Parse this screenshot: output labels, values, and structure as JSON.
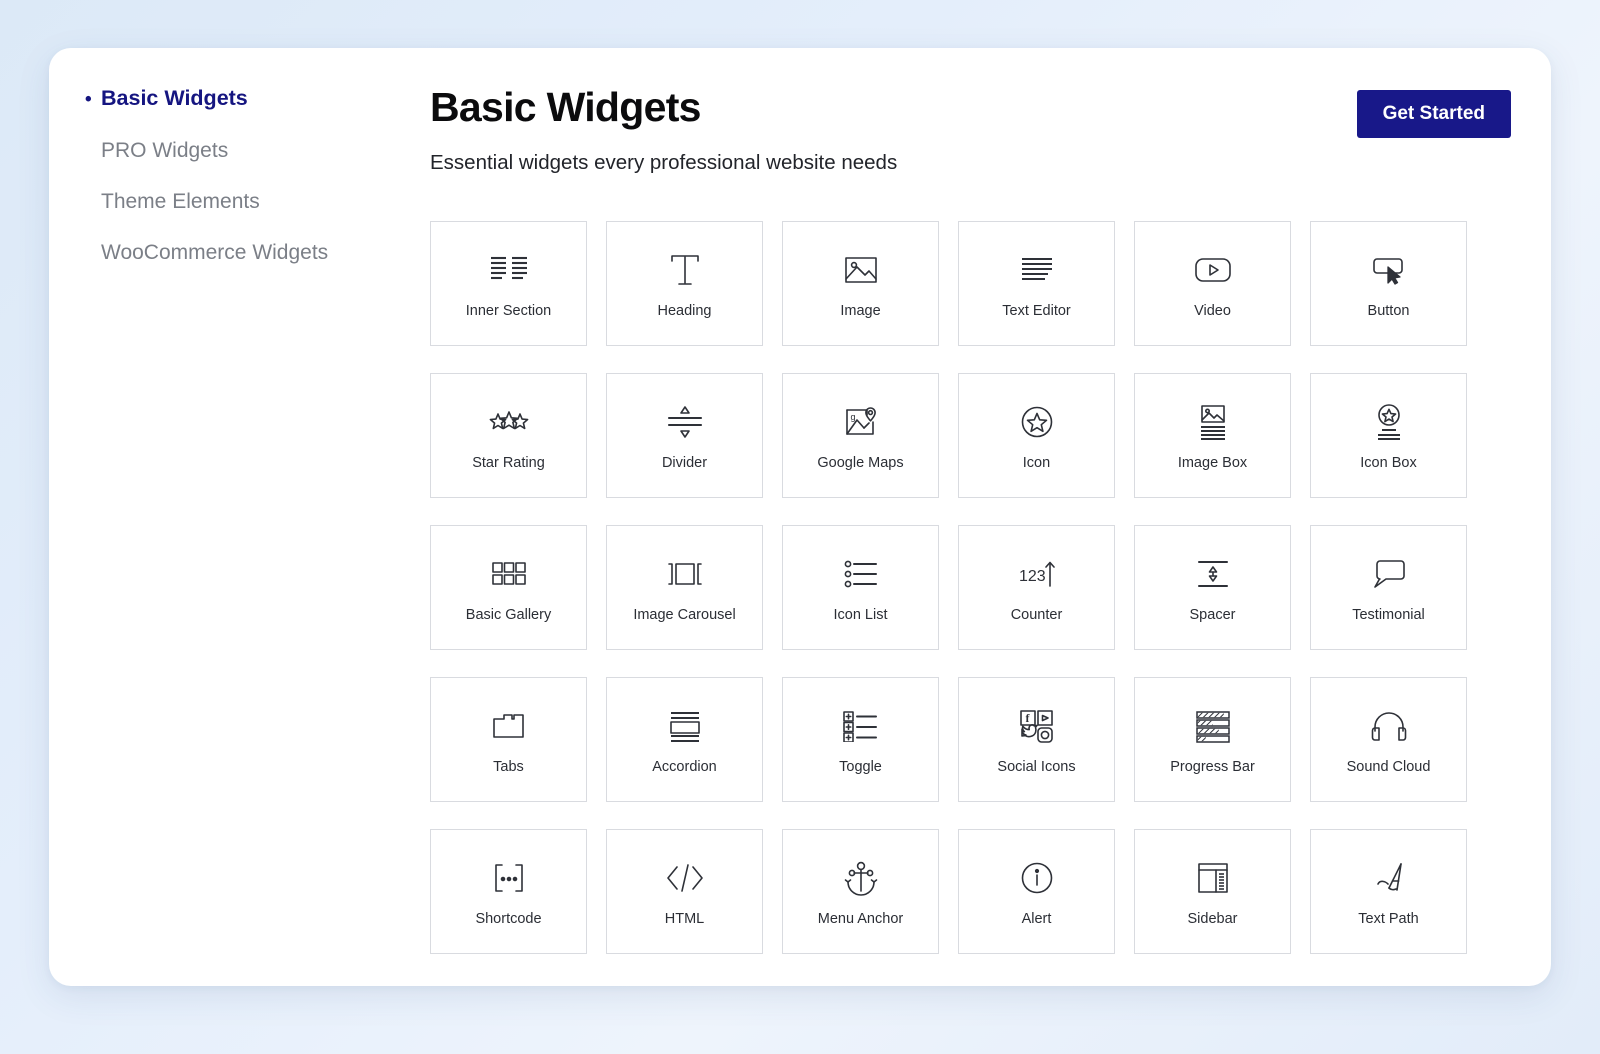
{
  "sidebar": {
    "items": [
      {
        "label": "Basic Widgets",
        "active": true,
        "bullet": "•"
      },
      {
        "label": "PRO Widgets",
        "active": false,
        "bullet": "•"
      },
      {
        "label": "Theme Elements",
        "active": false,
        "bullet": "•"
      },
      {
        "label": "WooCommerce Widgets",
        "active": false,
        "bullet": "•"
      }
    ]
  },
  "header": {
    "title": "Basic Widgets",
    "subtitle": "Essential widgets every professional website needs",
    "cta_label": "Get Started"
  },
  "colors": {
    "accent": "#181889",
    "active_nav": "#151580",
    "card_border": "#d9dbe0",
    "page_background": "#e4eefb",
    "panel_background": "#ffffff",
    "icon_stroke": "#2e3138"
  },
  "widgets": [
    {
      "label": "Inner Section",
      "icon": "inner-section-icon"
    },
    {
      "label": "Heading",
      "icon": "heading-icon"
    },
    {
      "label": "Image",
      "icon": "image-icon"
    },
    {
      "label": "Text Editor",
      "icon": "text-editor-icon"
    },
    {
      "label": "Video",
      "icon": "video-icon"
    },
    {
      "label": "Button",
      "icon": "button-icon"
    },
    {
      "label": "Star Rating",
      "icon": "star-rating-icon"
    },
    {
      "label": "Divider",
      "icon": "divider-icon"
    },
    {
      "label": "Google Maps",
      "icon": "google-maps-icon"
    },
    {
      "label": "Icon",
      "icon": "icon-icon"
    },
    {
      "label": "Image Box",
      "icon": "image-box-icon"
    },
    {
      "label": "Icon Box",
      "icon": "icon-box-icon"
    },
    {
      "label": "Basic Gallery",
      "icon": "basic-gallery-icon"
    },
    {
      "label": "Image Carousel",
      "icon": "image-carousel-icon"
    },
    {
      "label": "Icon List",
      "icon": "icon-list-icon"
    },
    {
      "label": "Counter",
      "icon": "counter-icon"
    },
    {
      "label": "Spacer",
      "icon": "spacer-icon"
    },
    {
      "label": "Testimonial",
      "icon": "testimonial-icon"
    },
    {
      "label": "Tabs",
      "icon": "tabs-icon"
    },
    {
      "label": "Accordion",
      "icon": "accordion-icon"
    },
    {
      "label": "Toggle",
      "icon": "toggle-icon"
    },
    {
      "label": "Social Icons",
      "icon": "social-icons-icon"
    },
    {
      "label": "Progress Bar",
      "icon": "progress-bar-icon"
    },
    {
      "label": "Sound Cloud",
      "icon": "sound-cloud-icon"
    },
    {
      "label": "Shortcode",
      "icon": "shortcode-icon"
    },
    {
      "label": "HTML",
      "icon": "html-icon"
    },
    {
      "label": "Menu Anchor",
      "icon": "menu-anchor-icon"
    },
    {
      "label": "Alert",
      "icon": "alert-icon"
    },
    {
      "label": "Sidebar",
      "icon": "sidebar-icon"
    },
    {
      "label": "Text Path",
      "icon": "text-path-icon"
    }
  ]
}
